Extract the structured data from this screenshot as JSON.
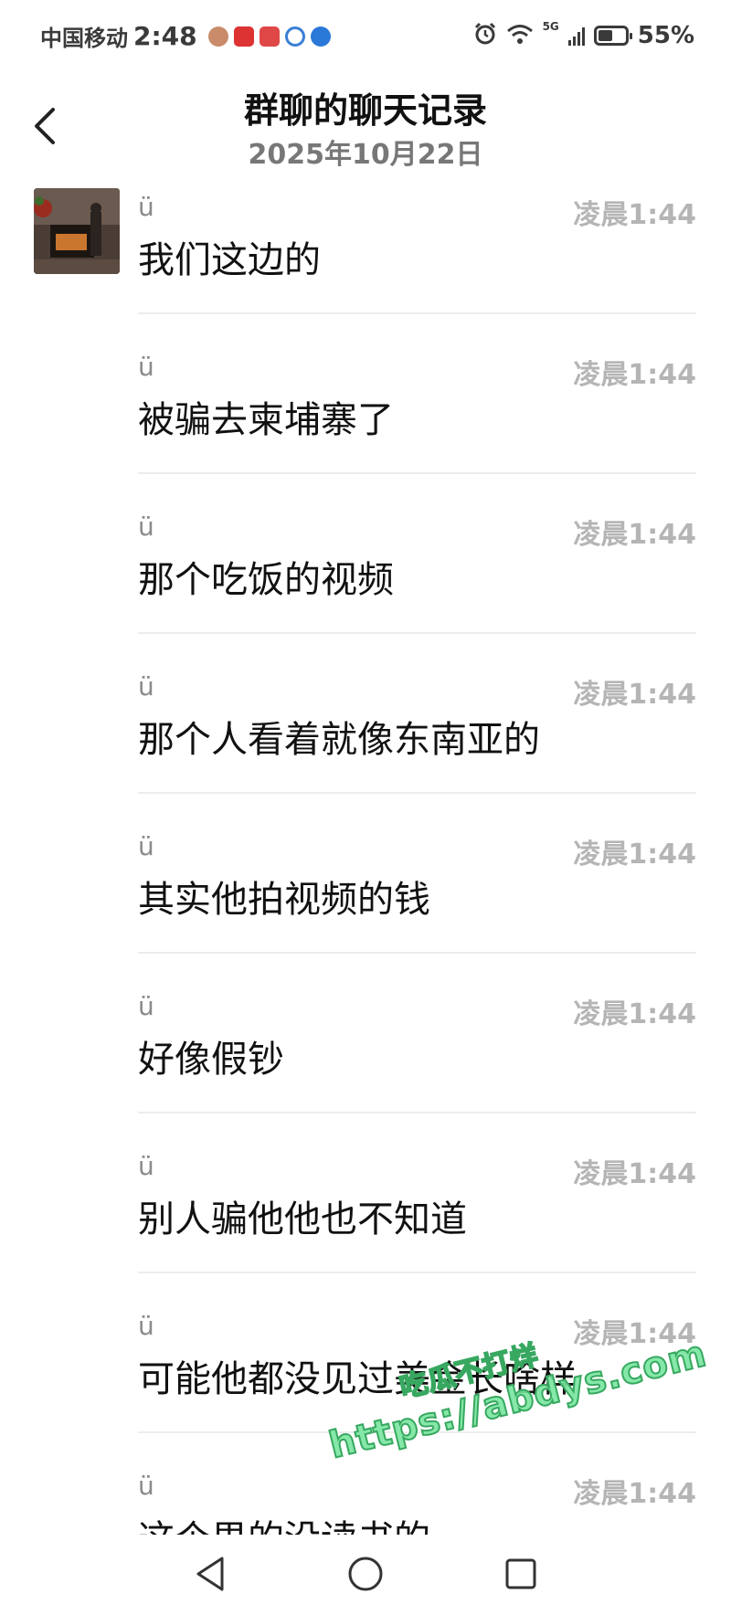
{
  "status_bar": {
    "carrier": "中国移动",
    "time": "2:48",
    "network_label": "5G",
    "battery_percent": "55%",
    "battery_level": 0.55,
    "icons": [
      "alarm-icon",
      "wifi-icon",
      "signal-icon",
      "battery-icon"
    ]
  },
  "header": {
    "title": "群聊的聊天记录",
    "date": "2025年10月22日"
  },
  "messages": [
    {
      "sender": "ü",
      "time": "凌晨1:44",
      "text": "我们这边的"
    },
    {
      "sender": "ü",
      "time": "凌晨1:44",
      "text": "被骗去柬埔寨了"
    },
    {
      "sender": "ü",
      "time": "凌晨1:44",
      "text": "那个吃饭的视频"
    },
    {
      "sender": "ü",
      "time": "凌晨1:44",
      "text": "那个人看着就像东南亚的"
    },
    {
      "sender": "ü",
      "time": "凌晨1:44",
      "text": "其实他拍视频的钱"
    },
    {
      "sender": "ü",
      "time": "凌晨1:44",
      "text": "好像假钞"
    },
    {
      "sender": "ü",
      "time": "凌晨1:44",
      "text": "别人骗他他也不知道"
    },
    {
      "sender": "ü",
      "time": "凌晨1:44",
      "text": "可能他都没见过美金长啥样"
    },
    {
      "sender": "ü",
      "time": "凌晨1:44",
      "text": "这个男的没读书的"
    }
  ],
  "watermark": {
    "line1": "吃瓜不打烊",
    "line2": "https://abdys.com"
  },
  "nav_icons": [
    "back-triangle-icon",
    "home-circle-icon",
    "recents-square-icon"
  ]
}
